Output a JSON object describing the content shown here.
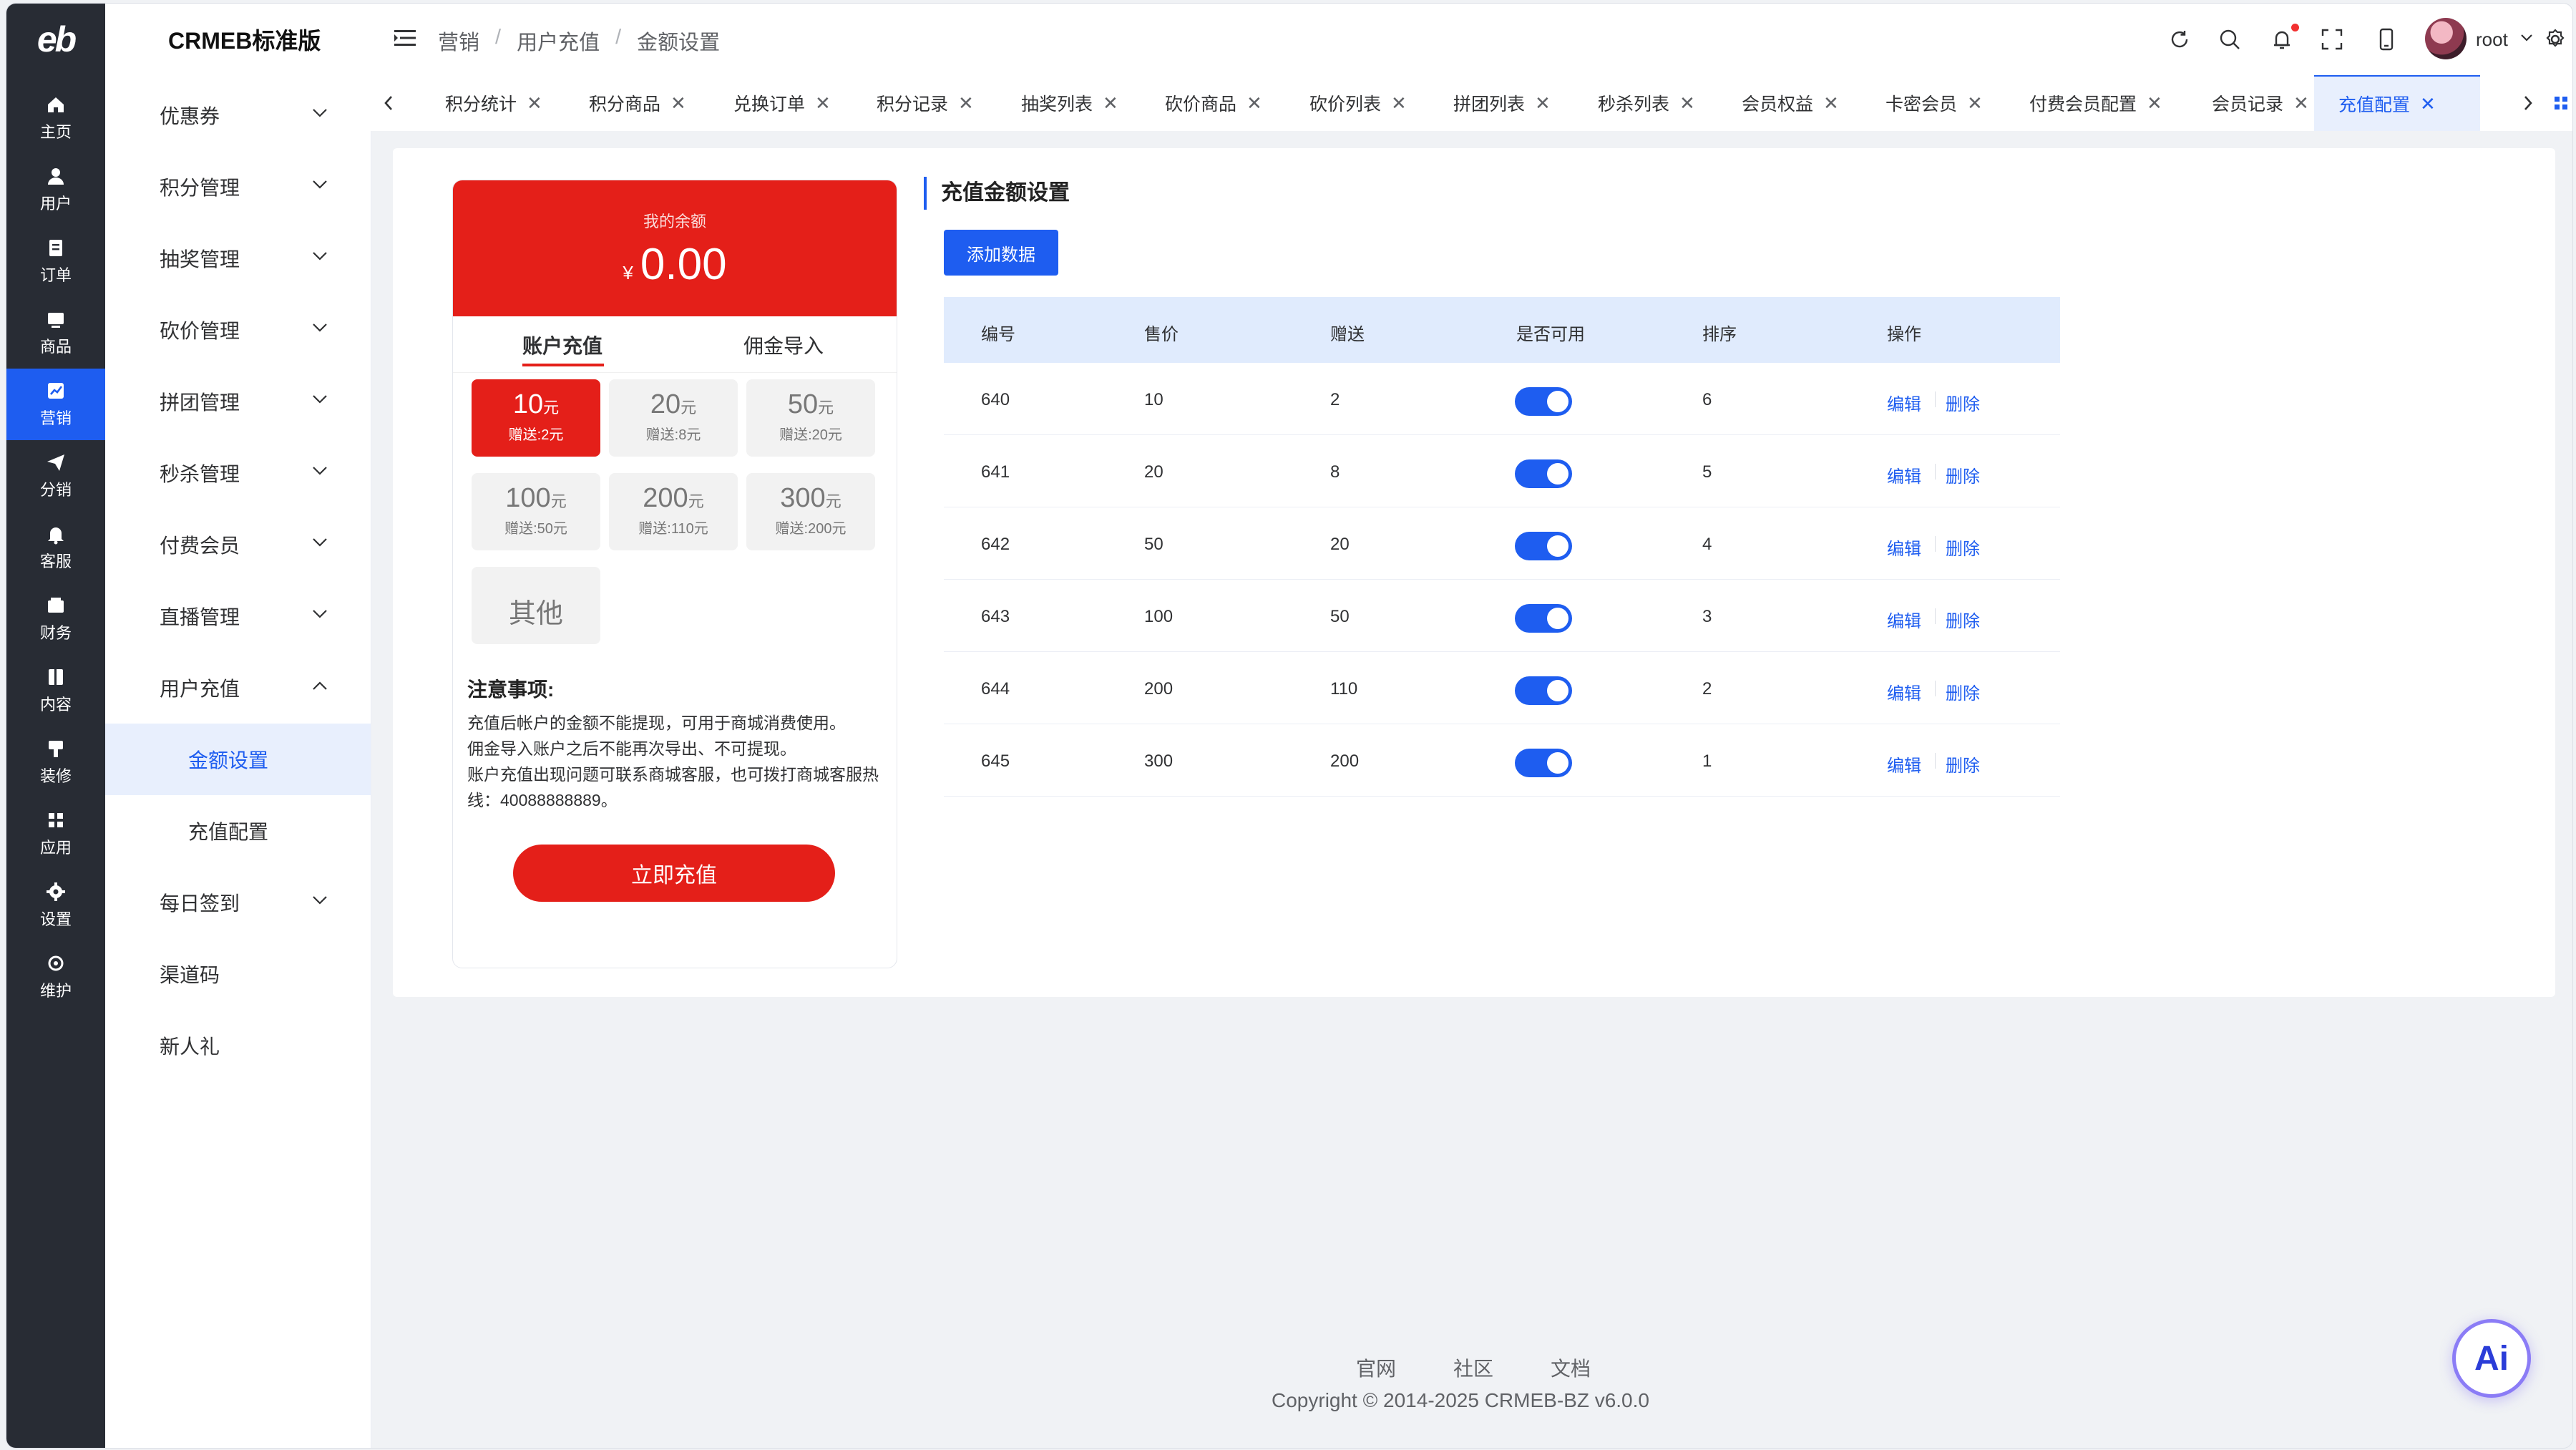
{
  "app": {
    "brand": "CRMEB标准版",
    "logo": "eb"
  },
  "rail": {
    "items": [
      {
        "label": "主页",
        "icon": "home-icon"
      },
      {
        "label": "用户",
        "icon": "user-icon"
      },
      {
        "label": "订单",
        "icon": "order-icon"
      },
      {
        "label": "商品",
        "icon": "goods-icon"
      },
      {
        "label": "营销",
        "icon": "marketing-icon",
        "active": true
      },
      {
        "label": "分销",
        "icon": "send-icon"
      },
      {
        "label": "客服",
        "icon": "bell-icon"
      },
      {
        "label": "财务",
        "icon": "wallet-icon"
      },
      {
        "label": "内容",
        "icon": "book-icon"
      },
      {
        "label": "装修",
        "icon": "brush-icon"
      },
      {
        "label": "应用",
        "icon": "apps-icon"
      },
      {
        "label": "设置",
        "icon": "gear-icon"
      },
      {
        "label": "维护",
        "icon": "maintenance-icon"
      }
    ]
  },
  "submenu": {
    "items": [
      {
        "label": "优惠券"
      },
      {
        "label": "积分管理"
      },
      {
        "label": "抽奖管理"
      },
      {
        "label": "砍价管理"
      },
      {
        "label": "拼团管理"
      },
      {
        "label": "秒杀管理"
      },
      {
        "label": "付费会员"
      },
      {
        "label": "直播管理"
      },
      {
        "label": "用户充值",
        "expanded": true
      },
      {
        "label": "金额设置",
        "child": true,
        "active": true
      },
      {
        "label": "充值配置",
        "child": true
      },
      {
        "label": "每日签到"
      },
      {
        "label": "渠道码"
      },
      {
        "label": "新人礼"
      }
    ]
  },
  "header": {
    "breadcrumb": [
      "营销",
      "用户充值",
      "金额设置"
    ],
    "user": "root",
    "icons": [
      "refresh-icon",
      "search-icon",
      "bell-icon",
      "fullscreen-icon",
      "mobile-icon",
      "gear-icon"
    ]
  },
  "tabs": {
    "items": [
      {
        "label": "积分统计"
      },
      {
        "label": "积分商品"
      },
      {
        "label": "兑换订单"
      },
      {
        "label": "积分记录"
      },
      {
        "label": "抽奖列表"
      },
      {
        "label": "砍价商品"
      },
      {
        "label": "砍价列表"
      },
      {
        "label": "拼团列表"
      },
      {
        "label": "秒杀列表"
      },
      {
        "label": "会员权益"
      },
      {
        "label": "卡密会员"
      },
      {
        "label": "付费会员配置"
      },
      {
        "label": "会员记录"
      },
      {
        "label": "充值配置",
        "active": true
      }
    ],
    "close_glyph": "✕"
  },
  "preview": {
    "balance_label": "我的余额",
    "currency": "¥",
    "balance": "0.00",
    "tabs": [
      "账户充值",
      "佣金导入"
    ],
    "amounts": [
      {
        "value": "10",
        "unit": "元",
        "gift": "赠送:2元",
        "selected": true
      },
      {
        "value": "20",
        "unit": "元",
        "gift": "赠送:8元"
      },
      {
        "value": "50",
        "unit": "元",
        "gift": "赠送:20元"
      },
      {
        "value": "100",
        "unit": "元",
        "gift": "赠送:50元"
      },
      {
        "value": "200",
        "unit": "元",
        "gift": "赠送:110元"
      },
      {
        "value": "300",
        "unit": "元",
        "gift": "赠送:200元"
      }
    ],
    "other_label": "其他",
    "notes_title": "注意事项:",
    "notes": [
      "充值后帐户的金额不能提现，可用于商城消费使用。",
      "佣金导入账户之后不能再次导出、不可提现。",
      "账户充值出现问题可联系商城客服，也可拨打商城客服热线：40088888889。"
    ],
    "submit_label": "立即充值"
  },
  "panel": {
    "title": "充值金额设置",
    "add_button": "添加数据",
    "columns": [
      "编号",
      "售价",
      "赠送",
      "是否可用",
      "排序",
      "操作"
    ],
    "rows": [
      {
        "id": "640",
        "price": "10",
        "gift": "2",
        "enabled": true,
        "sort": "6"
      },
      {
        "id": "641",
        "price": "20",
        "gift": "8",
        "enabled": true,
        "sort": "5"
      },
      {
        "id": "642",
        "price": "50",
        "gift": "20",
        "enabled": true,
        "sort": "4"
      },
      {
        "id": "643",
        "price": "100",
        "gift": "50",
        "enabled": true,
        "sort": "3"
      },
      {
        "id": "644",
        "price": "200",
        "gift": "110",
        "enabled": true,
        "sort": "2"
      },
      {
        "id": "645",
        "price": "300",
        "gift": "200",
        "enabled": true,
        "sort": "1"
      }
    ],
    "edit_label": "编辑",
    "delete_label": "删除"
  },
  "footer": {
    "links": [
      "官网",
      "社区",
      "文档"
    ],
    "copyright": "Copyright © 2014-2025 CRMEB-BZ v6.0.0"
  },
  "ai_button": "Ai",
  "colors": {
    "primary": "#1e5df0",
    "rail_bg": "#282c34",
    "preview_red": "#e41f19",
    "table_header": "#e0ebfd"
  }
}
